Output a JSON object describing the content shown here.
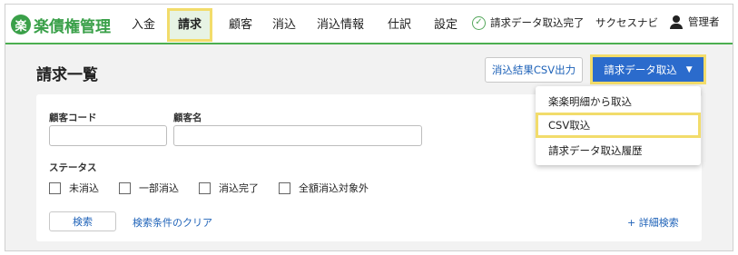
{
  "header": {
    "logo_mark": "楽",
    "logo_text": "楽債権管理",
    "nav": [
      {
        "label": "入金"
      },
      {
        "label": "請求"
      },
      {
        "label": "顧客"
      },
      {
        "label": "消込"
      },
      {
        "label": "消込情報"
      },
      {
        "label": "仕訳"
      },
      {
        "label": "設定"
      }
    ],
    "status_text": "請求データ取込完了",
    "status_icon": "check-circle-icon",
    "navi_link": "サクセスナビ",
    "user_label": "管理者",
    "accent_color": "#4caf50"
  },
  "page": {
    "title": "請求一覧",
    "export_button": "消込結果CSV出力",
    "import_button": "請求データ取込",
    "import_chevron": "⌄"
  },
  "dropdown": {
    "items": [
      {
        "label": "楽楽明細から取込"
      },
      {
        "label": "CSV取込"
      },
      {
        "label": "請求データ取込履歴"
      }
    ]
  },
  "search": {
    "customer_code_label": "顧客コード",
    "customer_code_value": "",
    "customer_name_label": "顧客名",
    "customer_name_value": "",
    "status_label": "ステータス",
    "statuses": [
      {
        "label": "未消込"
      },
      {
        "label": "一部消込"
      },
      {
        "label": "消込完了"
      },
      {
        "label": "全額消込対象外"
      }
    ],
    "search_button": "検索",
    "clear_link": "検索条件のクリア",
    "detail_link": "+ 詳細検索"
  }
}
